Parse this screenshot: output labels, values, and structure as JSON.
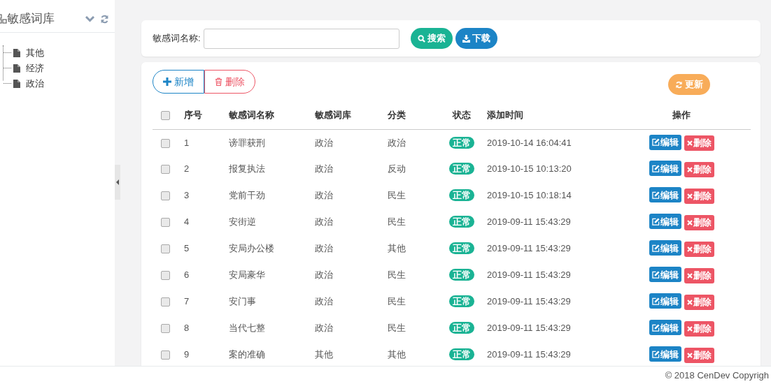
{
  "sidebar": {
    "title": "敏感词库",
    "tree": [
      {
        "label": "其他"
      },
      {
        "label": "经济"
      },
      {
        "label": "政治"
      }
    ]
  },
  "search": {
    "label": "敏感词名称:",
    "search_button": "搜索",
    "download_button": "下载"
  },
  "toolbar": {
    "add_button": "新增",
    "delete_button": "删除",
    "refresh_button": "更新"
  },
  "table": {
    "columns": [
      "序号",
      "敏感词名称",
      "敏感词库",
      "分类",
      "状态",
      "添加时间",
      "操作"
    ],
    "all_checked": false,
    "rows": [
      {
        "checked": false,
        "cells": [
          "1",
          "谤罪获刑",
          "政治",
          "政治"
        ],
        "status": "正常",
        "time": "2019-10-14 16:04:41",
        "edit": "编辑",
        "delete": "删除"
      },
      {
        "checked": false,
        "cells": [
          "2",
          "报复执法",
          "政治",
          "反动"
        ],
        "status": "正常",
        "time": "2019-10-15 10:13:20",
        "edit": "编辑",
        "delete": "删除"
      },
      {
        "checked": false,
        "cells": [
          "3",
          "党前干劲",
          "政治",
          "民生"
        ],
        "status": "正常",
        "time": "2019-10-15 10:18:14",
        "edit": "编辑",
        "delete": "删除"
      },
      {
        "checked": false,
        "cells": [
          "4",
          "安街逆",
          "政治",
          "民生"
        ],
        "status": "正常",
        "time": "2019-09-11 15:43:29",
        "edit": "编辑",
        "delete": "删除"
      },
      {
        "checked": false,
        "cells": [
          "5",
          "安局办公楼",
          "政治",
          "其他"
        ],
        "status": "正常",
        "time": "2019-09-11 15:43:29",
        "edit": "编辑",
        "delete": "删除"
      },
      {
        "checked": false,
        "cells": [
          "6",
          "安局豪华",
          "政治",
          "民生"
        ],
        "status": "正常",
        "time": "2019-09-11 15:43:29",
        "edit": "编辑",
        "delete": "删除"
      },
      {
        "checked": false,
        "cells": [
          "7",
          "安门事",
          "政治",
          "民生"
        ],
        "status": "正常",
        "time": "2019-09-11 15:43:29",
        "edit": "编辑",
        "delete": "删除"
      },
      {
        "checked": false,
        "cells": [
          "8",
          "当代七整",
          "政治",
          "民生"
        ],
        "status": "正常",
        "time": "2019-09-11 15:43:29",
        "edit": "编辑",
        "delete": "删除"
      },
      {
        "checked": false,
        "cells": [
          "9",
          "案的准确",
          "其他",
          "其他"
        ],
        "status": "正常",
        "time": "2019-09-11 15:43:29",
        "edit": "编辑",
        "delete": "删除"
      }
    ]
  },
  "footer": "© 2018 CenDev Copyrigh"
}
